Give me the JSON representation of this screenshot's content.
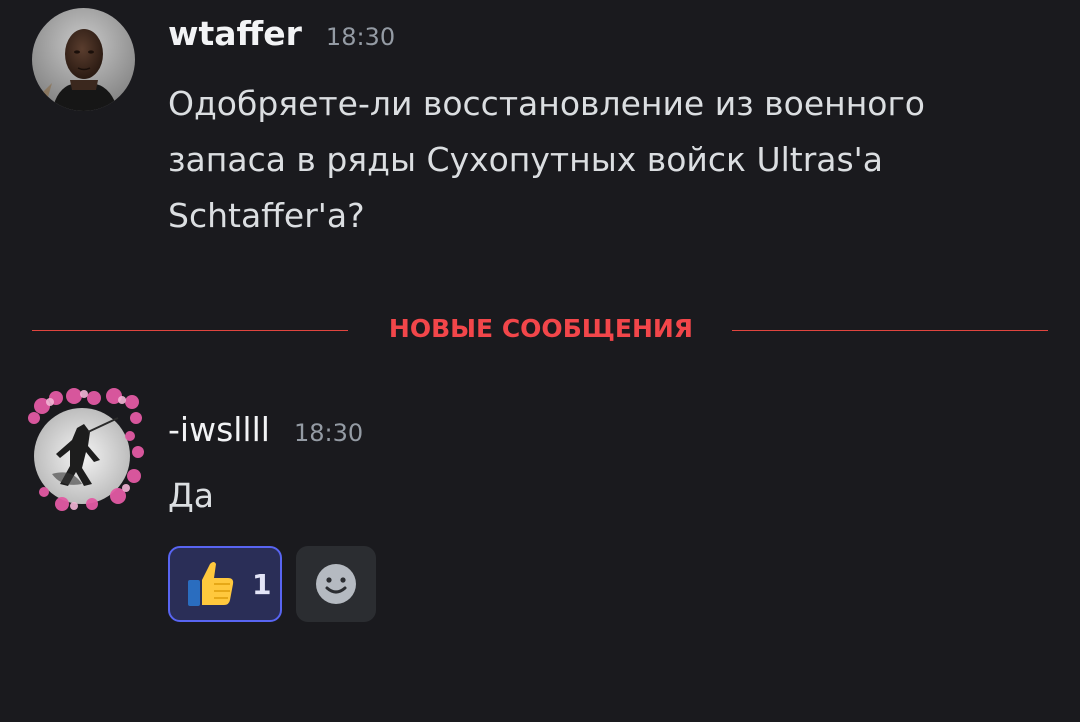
{
  "messages": [
    {
      "author": "wtaffer",
      "timestamp": "18:30",
      "text": "Одобряете-ли восстановление из военного запаса в ряды Сухопутных войск Ultras'a Schtaffer'a?",
      "avatar": "portrait-photo"
    },
    {
      "author": "-iwsllll",
      "timestamp": "18:30",
      "text": "Да",
      "avatar": "samurai-sakura-art",
      "reactions": [
        {
          "emoji": "thumbs-up-icon",
          "count": "1",
          "reacted_by_me": true
        }
      ]
    }
  ],
  "divider": {
    "label": "НОВЫЕ СООБЩЕНИЯ",
    "color": "#f2464a"
  },
  "add_reaction_icon": "smiley-add-icon",
  "colors": {
    "background": "#1a1a1e",
    "reaction_active_bg": "#2a2e57",
    "reaction_active_border": "#5865f2",
    "timestamp": "#949ba4"
  }
}
